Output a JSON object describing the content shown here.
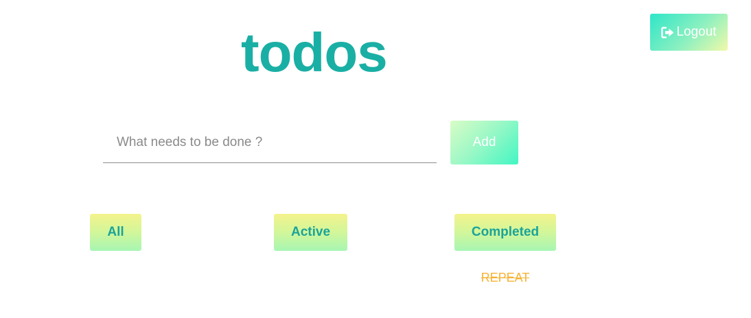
{
  "header": {
    "logout_label": "Logout",
    "logout_icon": "sign-out-icon"
  },
  "app": {
    "title": "todos"
  },
  "form": {
    "placeholder": "What needs to be done ?",
    "value": "",
    "add_label": "Add"
  },
  "filters": [
    {
      "label": "All"
    },
    {
      "label": "Active"
    },
    {
      "label": "Completed"
    }
  ],
  "todos": [
    {
      "text": "REPEAT",
      "completed": true
    }
  ],
  "colors": {
    "title": "#1aafa5",
    "filter_text": "#1aa39a",
    "completed_item": "#f5b335"
  }
}
